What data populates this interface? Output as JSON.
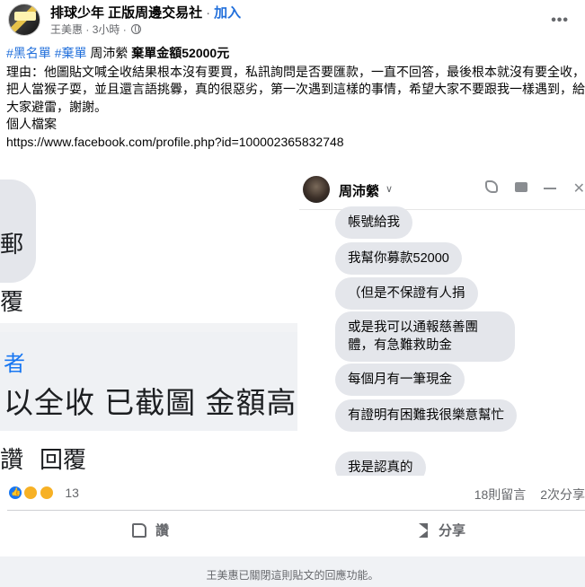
{
  "header": {
    "group_name": "排球少年 正版周邊交易社",
    "separator": "·",
    "join_label": "加入",
    "author": "王美惠",
    "time": "3小時",
    "more": "•••"
  },
  "post": {
    "tag1": "#黑名單",
    "tag2": "#棄單",
    "name": "周沛縈",
    "title_bold": "棄單金額52000元",
    "reason": "理由：他圖貼文喊全收結果根本沒有要買，私訊詢問是否要匯款，一直不回答，最後根本就沒有要全收，把人當猴子耍，並且還言語挑釁，真的很惡劣，第一次遇到這樣的事情，希望大家不要跟我一樣遇到，給大家避雷，謝謝。",
    "profile_label": "個人檔案",
    "profile_url": "https://www.facebook.com/profile.php?id=100002365832748"
  },
  "left_image": {
    "char_top": "郵",
    "char_mid": "覆",
    "char_blue": "者",
    "line": "以全收 已截圖 金額高",
    "char_bottom": "讚",
    "reply": "回覆"
  },
  "chat": {
    "name": "周沛縈",
    "caret": "∨",
    "messages": [
      "帳號給我",
      "我幫你募款52000",
      "（但是不保證有人捐",
      "或是我可以通報慈善團體，有急難救助金",
      "每個月有一筆現金",
      "有證明有困難我很樂意幫忙",
      "我是認真的"
    ],
    "close": "✕"
  },
  "footer_stats": {
    "reaction_count": "13",
    "comments": "18則留言",
    "shares": "2次分享"
  },
  "actions": {
    "like": "讚",
    "share": "分享"
  },
  "notice": "王美惠已關閉這則貼文的回應功能。"
}
